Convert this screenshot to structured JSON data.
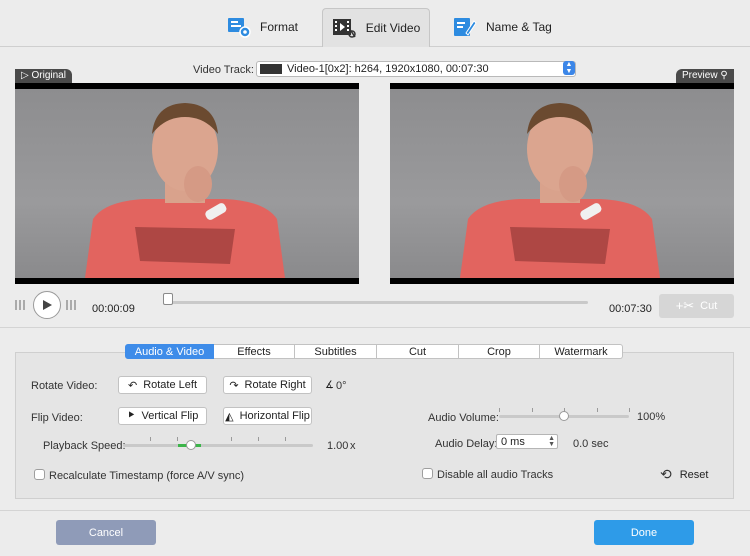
{
  "tabs": [
    {
      "label": "Format",
      "icon": "format-icon"
    },
    {
      "label": "Edit Video",
      "icon": "edit-video-icon"
    },
    {
      "label": "Name & Tag",
      "icon": "name-tag-icon"
    }
  ],
  "video_track": {
    "label": "Video Track:",
    "value": "Video-1[0x2]: h264, 1920x1080, 00:07:30"
  },
  "panels": {
    "original": "Original",
    "preview": "Preview"
  },
  "playback": {
    "current_time": "00:00:09",
    "end_time": "00:07:30",
    "cut_label": "Cut",
    "progress": 0.012
  },
  "edit_tabs": [
    "Audio & Video",
    "Effects",
    "Subtitles",
    "Cut",
    "Crop",
    "Watermark"
  ],
  "controls": {
    "rotate_label": "Rotate Video:",
    "rotate_left": "Rotate Left",
    "rotate_right": "Rotate Right",
    "rotate_value": "0°",
    "flip_label": "Flip Video:",
    "vertical_flip": "Vertical Flip",
    "horizontal_flip": "Horizontal Flip",
    "speed_label": "Playback Speed:",
    "speed_value": "1.00",
    "speed_unit": "x",
    "speed_fraction": 0.36,
    "recalc_label": "Recalculate Timestamp (force A/V sync)",
    "volume_label": "Audio Volume:",
    "volume_value": "100%",
    "volume_fraction": 0.5,
    "delay_label": "Audio Delay:",
    "delay_value": "0 ms",
    "delay_sec": "0.0 sec",
    "disable_audio_label": "Disable all audio Tracks",
    "reset_label": "Reset"
  },
  "footer": {
    "cancel": "Cancel",
    "done": "Done"
  },
  "colors": {
    "accent": "#3e8ce9",
    "done": "#2e9be8",
    "cancel": "#8f9bb8"
  }
}
